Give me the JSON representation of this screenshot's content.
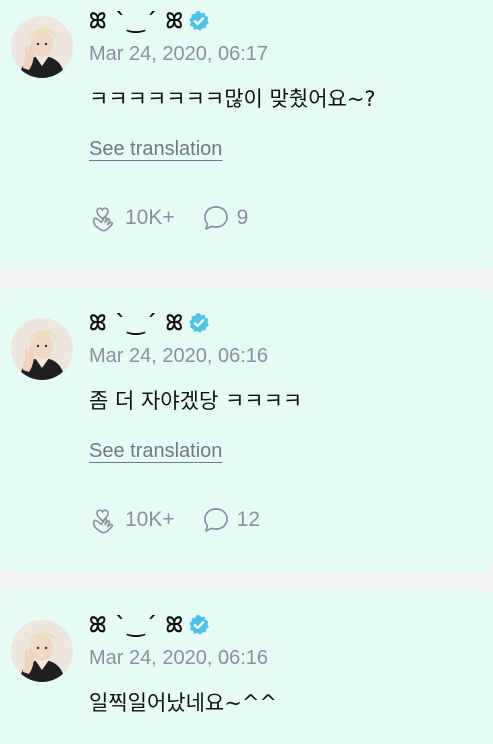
{
  "colors": {
    "card_background": "#e6fbf6",
    "page_background": "#f2f4f4",
    "verified_badge": "#4fc3e8",
    "muted_text": "#8a9296"
  },
  "posts": [
    {
      "display_name": "ꕤ ˋ‿ˊ ꕤ",
      "timestamp": "Mar 24, 2020, 06:17",
      "text": "ㅋㅋㅋㅋㅋㅋㅋ많이 맞췄어요~?",
      "translate_label": "See translation",
      "like_count": "10K+",
      "comment_count": "9",
      "like_icon": "heart-hand-icon",
      "comment_icon": "speech-bubble-icon"
    },
    {
      "display_name": "ꕤ ˋ‿ˊ ꕤ",
      "timestamp": "Mar 24, 2020, 06:16",
      "text": "좀 더 자야겠당 ㅋㅋㅋㅋ",
      "translate_label": "See translation",
      "like_count": "10K+",
      "comment_count": "12",
      "like_icon": "heart-hand-icon",
      "comment_icon": "speech-bubble-icon"
    },
    {
      "display_name": "ꕤ ˋ‿ˊ ꕤ",
      "timestamp": "Mar 24, 2020, 06:16",
      "text": "일찍일어났네요~^^"
    }
  ]
}
